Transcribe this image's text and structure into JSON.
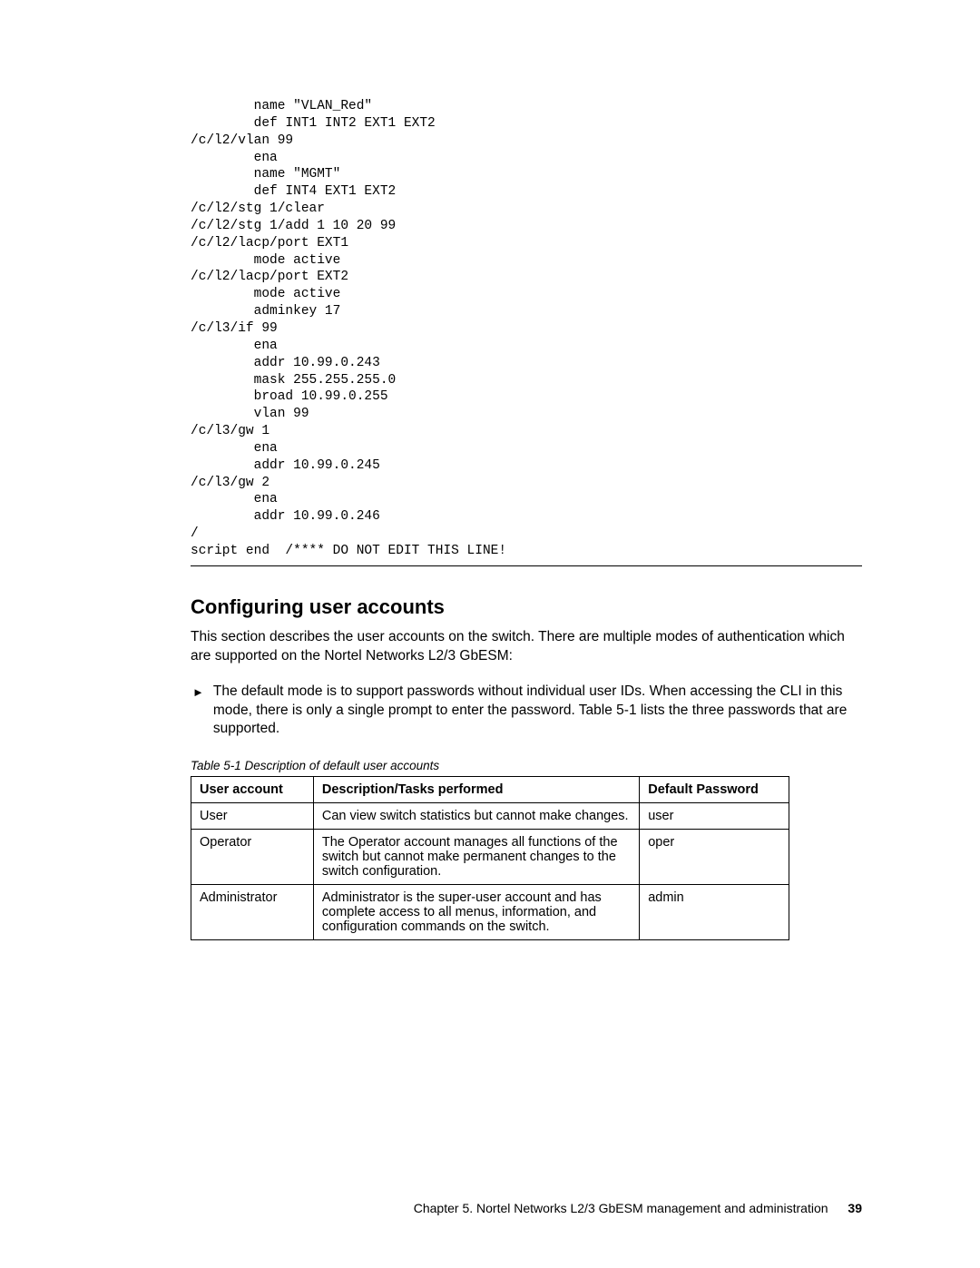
{
  "code": "        name \"VLAN_Red\"\n        def INT1 INT2 EXT1 EXT2\n/c/l2/vlan 99\n        ena\n        name \"MGMT\"\n        def INT4 EXT1 EXT2\n/c/l2/stg 1/clear\n/c/l2/stg 1/add 1 10 20 99\n/c/l2/lacp/port EXT1\n        mode active\n/c/l2/lacp/port EXT2\n        mode active\n        adminkey 17\n/c/l3/if 99\n        ena\n        addr 10.99.0.243\n        mask 255.255.255.0\n        broad 10.99.0.255\n        vlan 99\n/c/l3/gw 1\n        ena\n        addr 10.99.0.245\n/c/l3/gw 2\n        ena\n        addr 10.99.0.246\n/\nscript end  /**** DO NOT EDIT THIS LINE!",
  "heading": "Configuring user accounts",
  "intro": "This section describes the user accounts on the switch. There are multiple modes of authentication which are supported on the Nortel Networks L2/3 GbESM:",
  "bullet": "The default mode is to support passwords without individual user IDs. When accessing the CLI in this mode, there is only a single prompt to enter the password. Table 5-1 lists the three passwords that are supported.",
  "table_caption": "Table 5-1   Description of default user accounts",
  "table": {
    "headers": [
      "User account",
      "Description/Tasks performed",
      "Default Password"
    ],
    "rows": [
      {
        "account": "User",
        "desc": "Can view switch statistics but cannot make changes.",
        "pass": "user"
      },
      {
        "account": "Operator",
        "desc": "The Operator account manages all functions of the switch but cannot make permanent changes to the switch configuration.",
        "pass": "oper"
      },
      {
        "account": "Administrator",
        "desc": "Administrator is the super-user account and has complete access to all menus, information, and configuration commands on the switch.",
        "pass": "admin"
      }
    ]
  },
  "footer": {
    "chapter": "Chapter 5. Nortel Networks L2/3 GbESM management and administration",
    "page": "39"
  }
}
